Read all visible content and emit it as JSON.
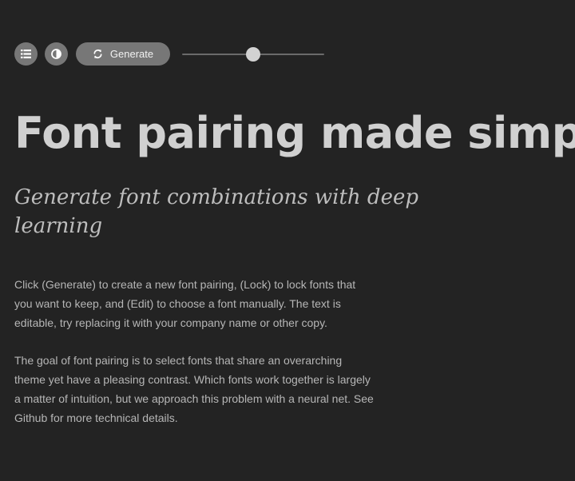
{
  "toolbar": {
    "list_icon": "list-icon",
    "contrast_icon": "contrast-icon",
    "refresh_icon": "refresh-icon",
    "generate_label": "Generate",
    "slider_value": 0.5
  },
  "main": {
    "headline": "Font pairing made simple",
    "subtitle": "Generate font combinations with deep learning",
    "paragraphs": [
      "Click (Generate) to create a new font pairing, (Lock) to lock fonts that you want to keep, and (Edit) to choose a font manually. The text is editable, try replacing it with your company name or other copy.",
      "The goal of font pairing is to select fonts that share an overarching theme yet have a pleasing contrast. Which fonts work together is largely a matter of intuition, but we approach this problem with a neural net. See Github for more technical details."
    ]
  },
  "colors": {
    "background": "#232323",
    "button": "#777777",
    "headline": "#d0d0d0",
    "body_text": "#b6b6b6"
  }
}
